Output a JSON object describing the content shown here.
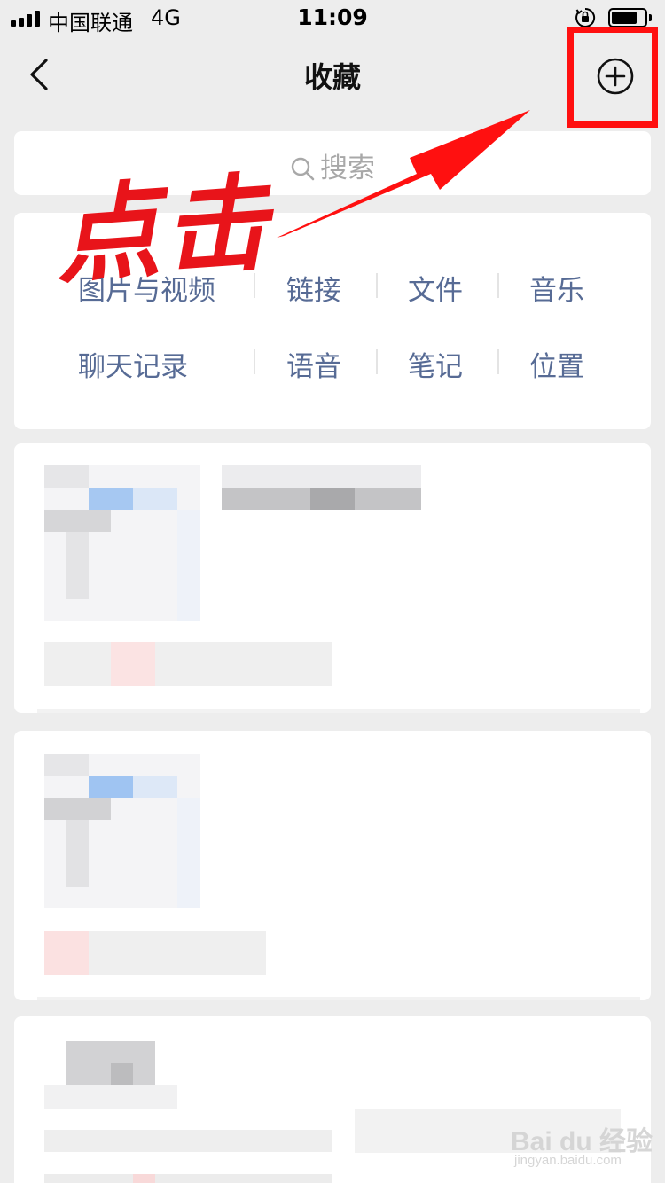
{
  "status_bar": {
    "carrier": "中国联通",
    "network": "4G",
    "time": "11:09"
  },
  "nav": {
    "title": "收藏"
  },
  "search": {
    "placeholder": "搜索"
  },
  "categories": {
    "row1": [
      "图片与视频",
      "链接",
      "文件",
      "音乐"
    ],
    "row2": [
      "聊天记录",
      "语音",
      "笔记",
      "位置"
    ]
  },
  "annotation": {
    "text": "点击"
  },
  "watermark": {
    "logo": "Bai du 经验",
    "url": "jingyan.baidu.com"
  },
  "colors": {
    "accent_link": "#576b95",
    "annotation_red": "#ff1010",
    "background": "#ededed"
  },
  "icons": [
    "signal-icon",
    "lock-rotation-icon",
    "battery-icon",
    "back-chevron-icon",
    "add-circle-icon",
    "search-icon"
  ]
}
